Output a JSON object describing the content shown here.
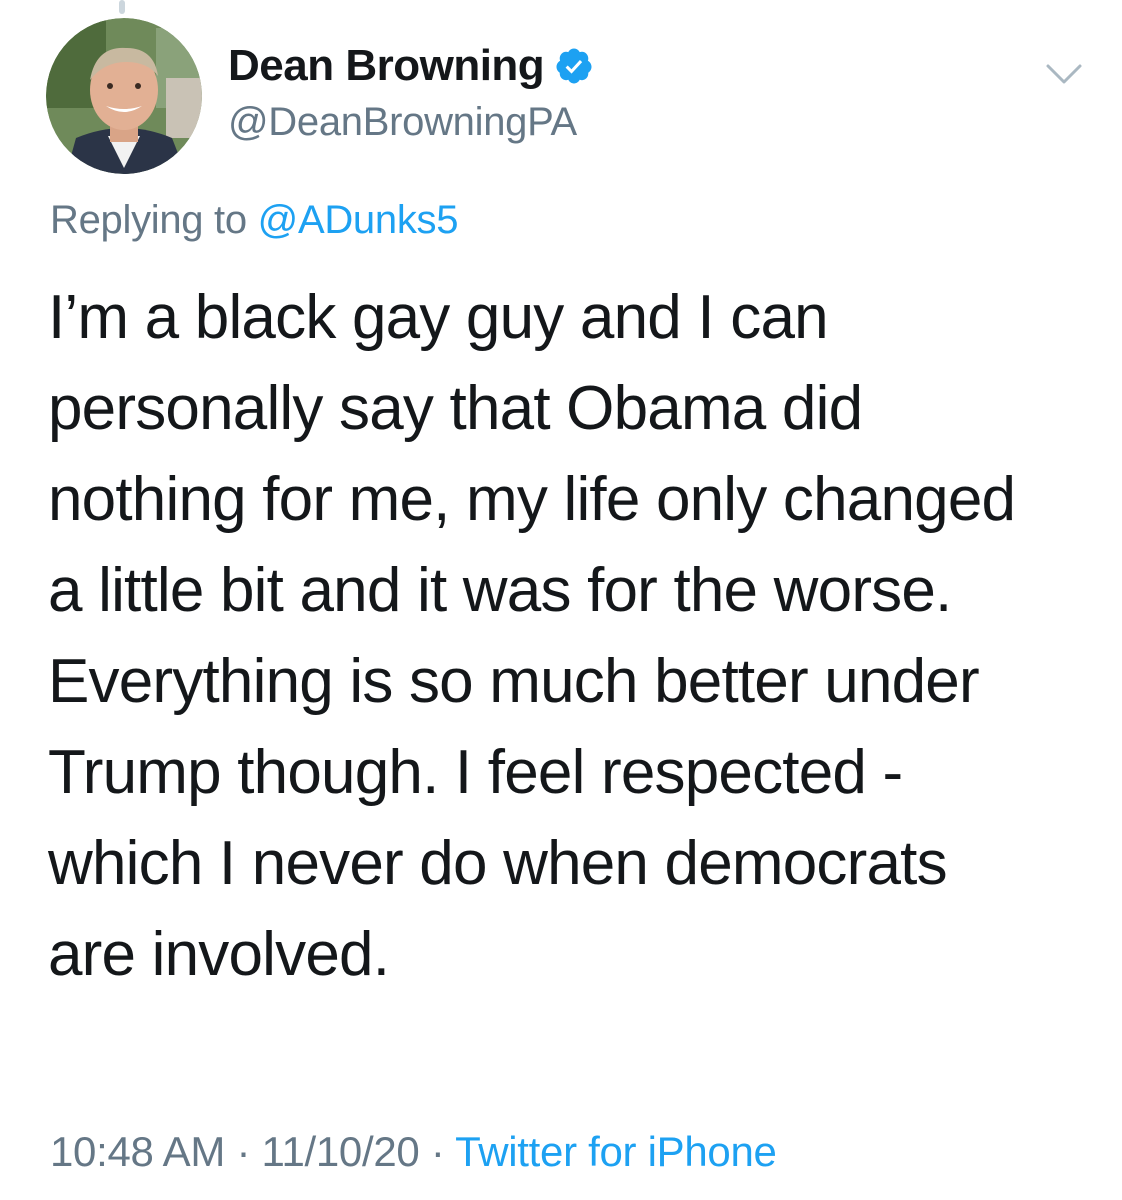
{
  "user": {
    "display_name": "Dean Browning",
    "handle": "@DeanBrowningPA",
    "verified": true,
    "avatar_icon": "profile-photo"
  },
  "reply": {
    "prefix": "Replying to",
    "to_handle": "@ADunks5"
  },
  "tweet": {
    "lines": [
      "I’m a black gay guy and I can",
      "personally say that Obama did",
      "nothing for me, my life only changed",
      "a little bit and it was for the worse.",
      "Everything is so much better under",
      "Trump though. I feel respected -",
      "which I never do when democrats",
      "are involved."
    ]
  },
  "meta": {
    "time": "10:48 AM",
    "separator": "·",
    "date": "11/10/20",
    "source": "Twitter for iPhone"
  },
  "icons": {
    "verified": "verified-badge-icon",
    "menu": "chevron-down-icon"
  },
  "colors": {
    "text": "#14171a",
    "secondary": "#657786",
    "accent": "#1da1f2"
  }
}
